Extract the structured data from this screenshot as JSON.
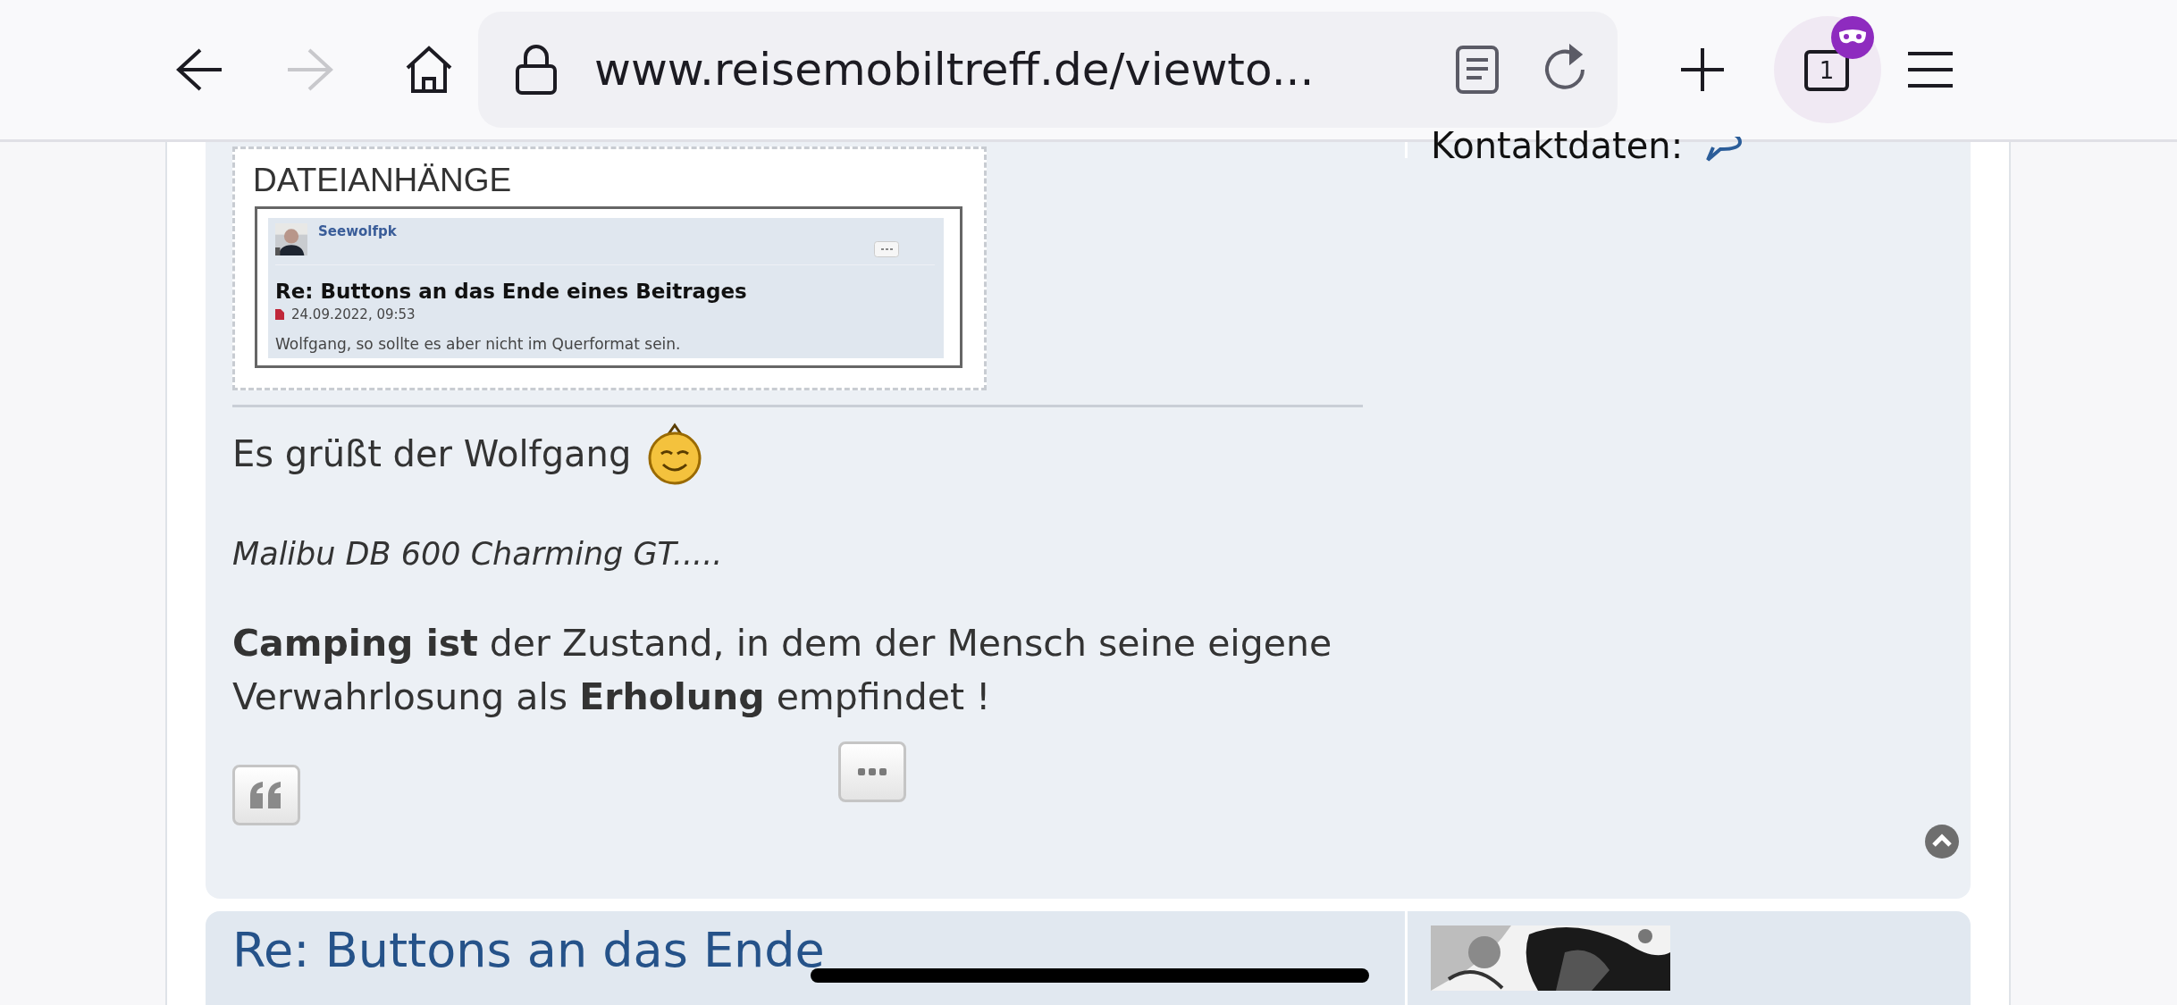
{
  "toolbar": {
    "nav_buttons": [
      {
        "kind": "back",
        "disabled": false
      },
      {
        "kind": "forward",
        "disabled": true
      }
    ],
    "url": "www.reisemobiltreff.de/viewto...",
    "tab_count": "1"
  },
  "post": {
    "attachments_label": "DATEIANHÄNGE",
    "attachment": {
      "author": "Seewolfpk",
      "title": "Re: Buttons an das Ende eines Beitrages",
      "date": "24.09.2022, 09:53",
      "text": "Wolfgang, so sollte es aber nicht im Querformat sein."
    },
    "greeting": "Es grüßt der Wolfgang",
    "vehicle": "Malibu DB 600 Charming GT.....",
    "motto": "**Camping ist** der Zustand, in dem der Mensch seine eigene Verwahrlosung als **Erholung** empfindet !",
    "profile_text": "Kontaktdaten:"
  },
  "next_post": {
    "title": "Re: Buttons an das Ende"
  }
}
